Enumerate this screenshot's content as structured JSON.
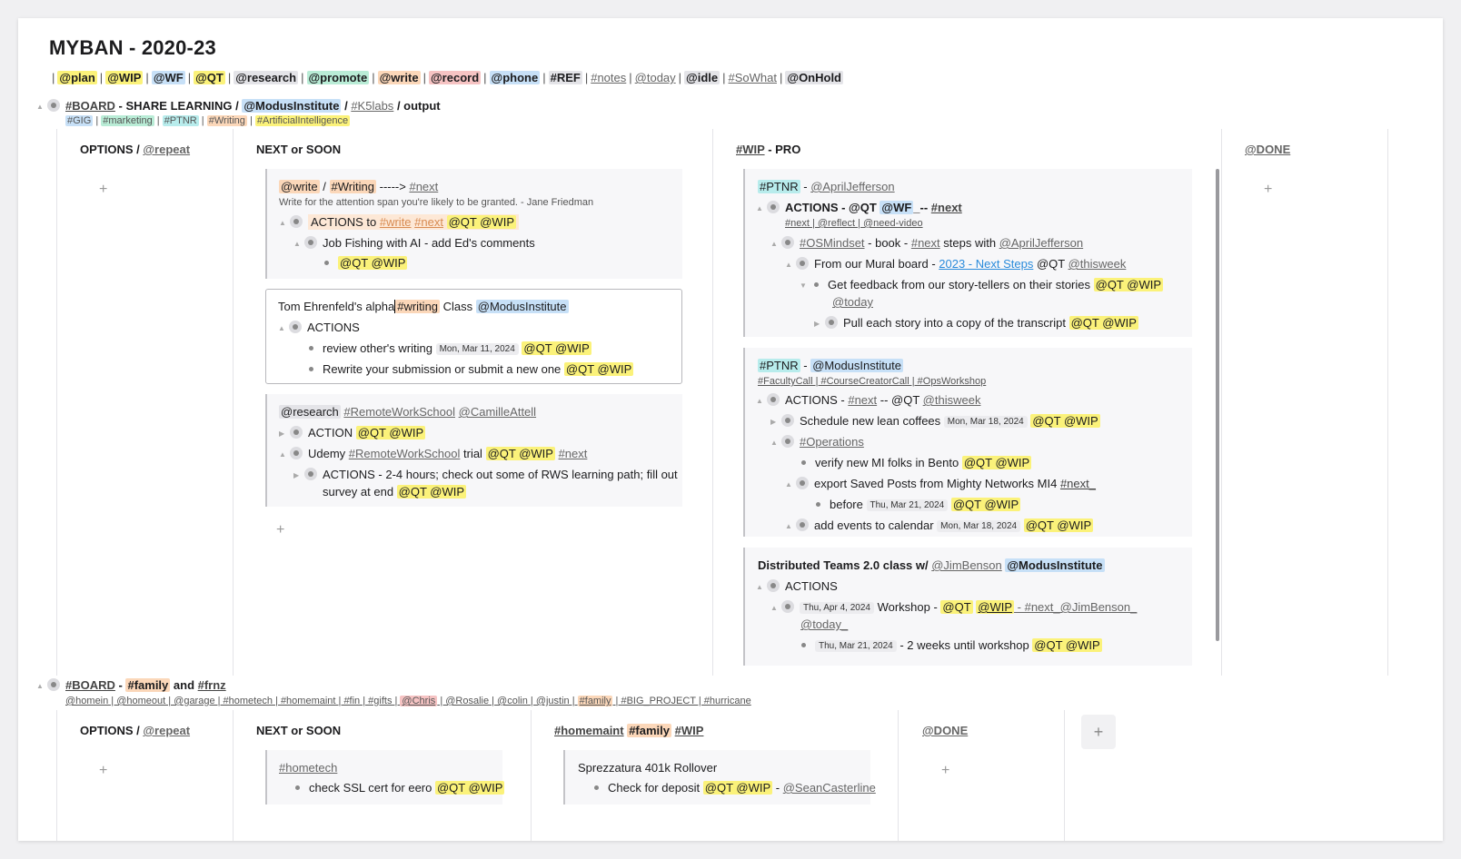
{
  "title": "MYBAN - 2020-23",
  "tagline": [
    "@plan",
    "@WIP",
    "@WF",
    "@QT",
    "@research",
    "@promote",
    "@write",
    "@record",
    "@phone",
    "#REF",
    "#notes",
    "@today",
    "@idle",
    "#SoWhat",
    "@OnHold"
  ],
  "board1": {
    "head": {
      "a": "#BOARD",
      "b": "- SHARE LEARNING /",
      "c": "@ModusInstitute",
      "d": "/",
      "e": "#K5labs",
      "f": "/ output"
    },
    "tags": [
      "#GIG",
      "#marketing",
      "#PTNR",
      "#Writing",
      "#ArtificialIntelligence"
    ],
    "col_options": {
      "title": "OPTIONS /",
      "tag": "@repeat"
    },
    "col_next": {
      "title": "NEXT or SOON"
    },
    "col_wip": {
      "tag": "#WIP",
      "title": "- PRO"
    },
    "col_done": {
      "title": "@DONE"
    },
    "card1": {
      "l1a": "@write",
      "l1b": "/",
      "l1c": "#Writing",
      "l1d": "-----> ",
      "l1e": "#next",
      "quote": "Write for the attention span you're likely to be granted. - Jane Friedman",
      "l2a": "ACTIONS to ",
      "l2b": "#write",
      "l2c": "#next",
      "l2d": "@QT @WIP",
      "l3": "Job Fishing with AI - add Ed's comments",
      "l4": "@QT @WIP"
    },
    "card2": {
      "l1a": "Tom Ehrenfeld's alpha",
      "l1b": "#writing",
      "l1c": " Class ",
      "l1d": "@ModusInstitute",
      "l2": "ACTIONS",
      "l3": "review other's writing",
      "l3d": "Mon, Mar 11, 2024",
      "l3t": "@QT @WIP",
      "l4": "Rewrite your submission or submit a new one",
      "l4t": "@QT @WIP"
    },
    "card3": {
      "l1a": "@research",
      "l1b": "#RemoteWorkSchool",
      "l1c": "@CamilleAttell",
      "l2": "ACTION",
      "l2t": "@QT @WIP",
      "l3a": "Udemy ",
      "l3b": "#RemoteWorkSchool",
      "l3c": " trial ",
      "l3d": "@QT @WIP",
      "l3e": "#next",
      "l4": "ACTIONS - 2-4 hours; check out some of RWS learning path; fill out",
      "l5": "survey at end",
      "l5t": "@QT @WIP"
    },
    "wip1": {
      "l1a": "#PTNR",
      "l1b": " - ",
      "l1c": "@AprilJefferson",
      "l2a": "ACTIONS -  @QT ",
      "l2b": "@WF",
      "l2c": "_-- ",
      "l2d": "#next",
      "l3": "#next | @reflect | @need-video",
      "l4a": "#OSMindset",
      "l4b": " - book - ",
      "l4c": "#next",
      "l4d": " steps with ",
      "l4e": "@AprilJefferson",
      "l5a": "From our Mural board - ",
      "l5b": "2023 - Next Steps",
      "l5c": " @QT ",
      "l5d": "@thisweek",
      "l6a": "Get feedback from our story-tellers on their stories ",
      "l6b": "@QT @WIP",
      "l6c": "@today",
      "l7a": "Pull each story into a copy of the transcript ",
      "l7b": "@QT @WIP"
    },
    "wip2": {
      "l1a": "#PTNR",
      "l1b": " - ",
      "l1c": "@ModusInstitute",
      "l2": "#FacultyCall | #CourseCreatorCall | #OpsWorkshop",
      "l3a": "ACTIONS - ",
      "l3b": "#next",
      "l3c": " -- @QT ",
      "l3d": "@thisweek",
      "l4a": "Schedule new lean coffees",
      "l4d": "Mon, Mar 18, 2024",
      "l4t": "@QT @WIP",
      "l5": "#Operations",
      "l6a": "verify new MI folks in Bento ",
      "l6t": "@QT @WIP",
      "l7a": "export Saved Posts from Mighty Networks MI4 ",
      "l7b": "#next_",
      "l8a": "before",
      "l8d": "Thu, Mar 21, 2024",
      "l8t": "@QT @WIP",
      "l9a": "add events to calendar",
      "l9d": "Mon, Mar 18, 2024",
      "l9t": "@QT @WIP"
    },
    "wip3": {
      "l1a": "Distributed Teams 2.0 class w/ ",
      "l1b": "@JimBenson",
      "l1c": "@ModusInstitute",
      "l2": "ACTIONS",
      "l3d": "Thu, Apr 4, 2024",
      "l3a": " Workshop - ",
      "l3b": "@QT",
      "l3c": "@WIP",
      "l3e": " - #next_@JimBenson_",
      "l3f": "@today_",
      "l4d": "Thu, Mar 21, 2024",
      "l4a": " - 2 weeks until workshop ",
      "l4t": "@QT @WIP"
    }
  },
  "board2": {
    "head": {
      "a": "#BOARD",
      "b": " - ",
      "c": "#family",
      "d": " and ",
      "e": "#frnz"
    },
    "tags_a": "@homein | @homeout | @garage | #hometech | #homemaint | #fin | #gifts | ",
    "tags_b": "@Chris",
    "tags_c": " | @Rosalie | @colin | @justin | ",
    "tags_d": "#family",
    "tags_e": " | #BIG_PROJECT | #hurricane",
    "col_options": {
      "title": "OPTIONS /",
      "tag": "@repeat"
    },
    "col_next": {
      "title": "NEXT or SOON"
    },
    "col_home": {
      "a": "#homemaint",
      "b": "#family",
      "c": "#WIP"
    },
    "col_done": {
      "title": "@DONE"
    },
    "card1": {
      "l1": "#hometech",
      "l2": "check SSL cert for eero ",
      "l2t": "@QT @WIP"
    },
    "card2": {
      "l1": "Sprezzatura 401k Rollover",
      "l2": "Check for deposit ",
      "l2t": "@QT @WIP",
      "l2c": " - ",
      "l2d": "@SeanCasterline"
    }
  },
  "plus": "+"
}
